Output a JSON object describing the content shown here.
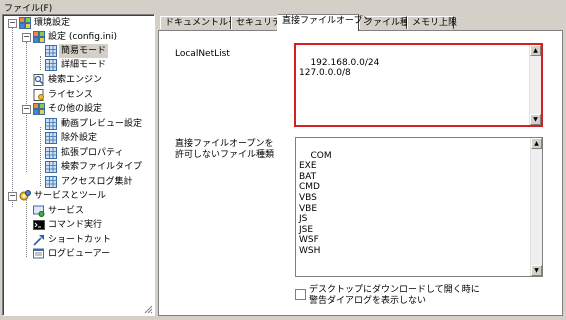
{
  "menubar": {
    "file": "ファイル(F)"
  },
  "tree": {
    "items": [
      {
        "label": "環境設定",
        "icon": "settings-root-icon"
      },
      {
        "label": "設定 (config.ini)",
        "icon": "settings-icon"
      },
      {
        "label": "簡易モード",
        "icon": "grid-icon"
      },
      {
        "label": "詳細モード",
        "icon": "grid-icon"
      },
      {
        "label": "検索エンジン",
        "icon": "search-engine-icon"
      },
      {
        "label": "ライセンス",
        "icon": "license-icon"
      },
      {
        "label": "その他の設定",
        "icon": "settings-icon"
      },
      {
        "label": "動画プレビュー設定",
        "icon": "grid-icon"
      },
      {
        "label": "除外設定",
        "icon": "grid-icon"
      },
      {
        "label": "拡張プロパティ",
        "icon": "grid-icon"
      },
      {
        "label": "検索ファイルタイプ",
        "icon": "grid-icon"
      },
      {
        "label": "アクセスログ集計",
        "icon": "grid-icon"
      },
      {
        "label": "サービスとツール",
        "icon": "services-tools-icon"
      },
      {
        "label": "サービス",
        "icon": "service-icon"
      },
      {
        "label": "コマンド実行",
        "icon": "command-icon"
      },
      {
        "label": "ショートカット",
        "icon": "shortcut-icon"
      },
      {
        "label": "ログビューアー",
        "icon": "log-viewer-icon"
      }
    ]
  },
  "tabs": [
    {
      "label": "ドキュメントルート"
    },
    {
      "label": "セキュリティ"
    },
    {
      "label": "直接ファイルオープン"
    },
    {
      "label": "ファイル種類"
    },
    {
      "label": "メモリ上限"
    }
  ],
  "form": {
    "local_net_list_label": "LocalNetList",
    "local_net_list_value": "192.168.0.0/24\n127.0.0.0/8",
    "disallowed_label_line1": "直接ファイルオープンを",
    "disallowed_label_line2": "許可しないファイル種類",
    "disallowed_types_value": "COM\nEXE\nBAT\nCMD\nVBS\nVBE\nJS\nJSE\nWSF\nWSH",
    "warn_checkbox_line1": "デスクトップにダウンロードして開く時に",
    "warn_checkbox_line2": "警告ダイアログを表示しない",
    "warn_checked": false
  },
  "colors": {
    "highlight_border": "#d42020",
    "window_bg": "#d4d0c8"
  }
}
